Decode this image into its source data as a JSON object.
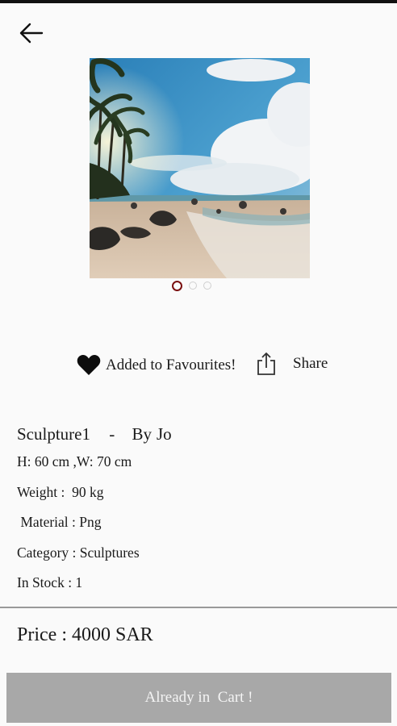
{
  "nav": {
    "back_icon": "arrow-left-icon"
  },
  "gallery": {
    "image": "beach-with-palm-trees",
    "slide_count": 3,
    "active_index": 0
  },
  "actions": {
    "favourite_icon": "heart-icon",
    "favourite_label": "Added to Favourites!",
    "share_icon": "share-icon",
    "share_label": "Share"
  },
  "product": {
    "name": "Sculpture1",
    "separator": "-",
    "by_label": "By",
    "artist": "Jo",
    "dimensions": "H: 60 cm ,W: 70 cm",
    "weight": "Weight :  90 kg",
    "material": " Material : Png",
    "category": "Category : Sculptures",
    "stock": "In Stock : 1"
  },
  "price": {
    "text": "Price : 4000 SAR"
  },
  "cart": {
    "button_label": "Already in  Cart !"
  },
  "colors": {
    "active_dot": "#7a1010",
    "cart_button": "#a8a8a8",
    "divider": "#9a9a9a"
  }
}
